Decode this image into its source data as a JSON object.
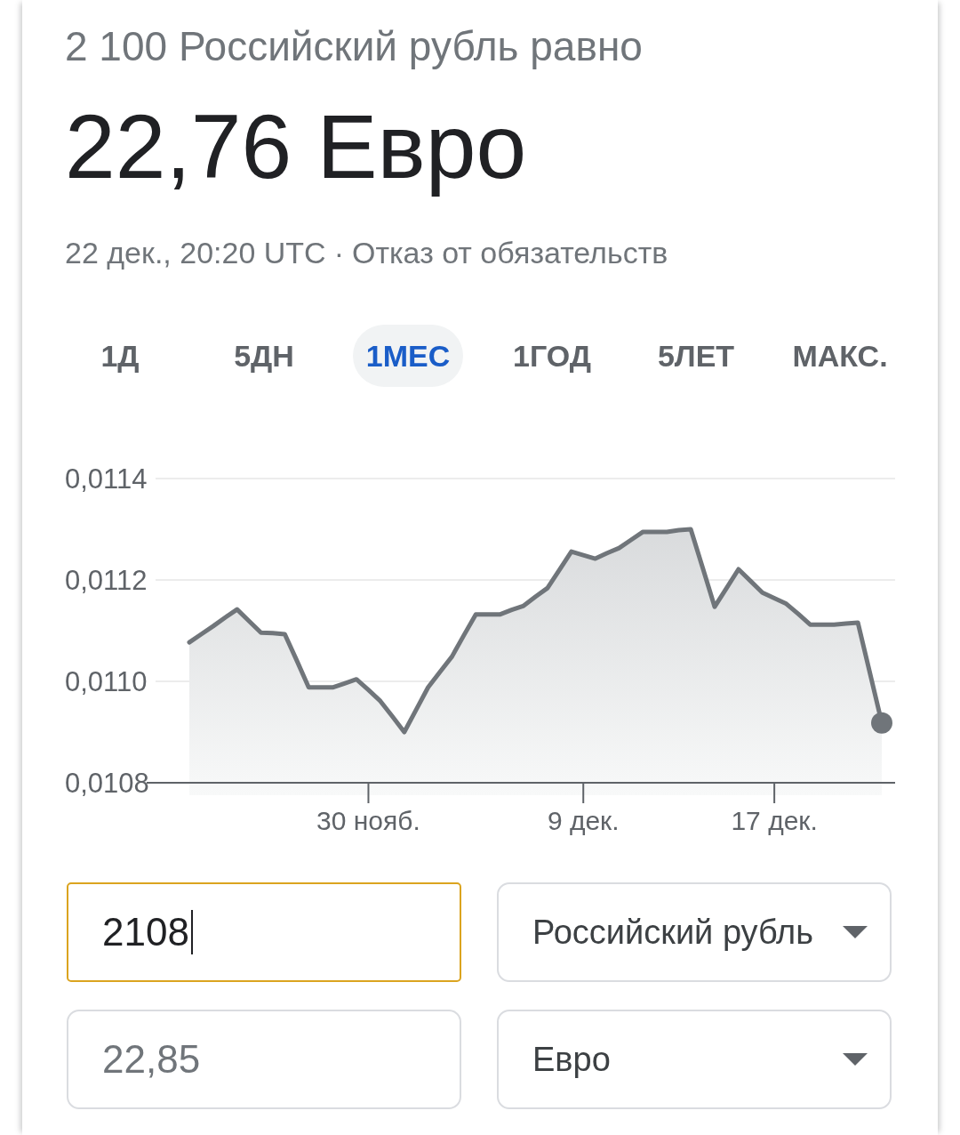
{
  "header": {
    "query": "2 100 Российский рубль равно",
    "result": "22,76 Евро",
    "timestamp": "22 дек., 20:20 UTC",
    "separator": "·",
    "disclaimer_link": "Отказ от обязательств"
  },
  "range_tabs": [
    {
      "label": "1Д",
      "selected": false
    },
    {
      "label": "5ДН",
      "selected": false
    },
    {
      "label": "1МЕС",
      "selected": true
    },
    {
      "label": "1ГОД",
      "selected": false
    },
    {
      "label": "5ЛЕТ",
      "selected": false
    },
    {
      "label": "МАКС.",
      "selected": false
    }
  ],
  "chart": {
    "chart_data": {
      "type": "area",
      "categories": [
        null,
        null,
        null,
        null,
        null,
        null,
        null,
        null,
        null,
        null,
        null,
        null,
        null,
        null,
        null,
        "30 нояб.",
        null,
        null,
        null,
        null,
        null,
        null,
        null,
        null,
        null,
        null,
        null,
        null,
        null,
        null,
        null,
        null,
        null,
        "9 дек.",
        null,
        null,
        null,
        null,
        null,
        null,
        null,
        null,
        null,
        null,
        null,
        null,
        null,
        null,
        null,
        "17 дек.",
        null,
        null,
        null,
        null,
        null,
        null,
        null,
        null,
        null
      ],
      "ylim": [
        0.0108,
        0.0114
      ],
      "yticks": [
        {
          "value": 0.0108,
          "label": "0,0108"
        },
        {
          "value": 0.011,
          "label": "0,0110"
        },
        {
          "value": 0.0112,
          "label": "0,0112"
        },
        {
          "value": 0.0114,
          "label": "0,0114"
        }
      ],
      "series": [
        {
          "color": "#70757a",
          "values": [
            0.011077,
            0.011093,
            0.011109,
            0.011126,
            0.011142,
            0.011119,
            0.011096,
            0.011095,
            0.011093,
            0.011041,
            0.010988,
            0.010988,
            0.010988,
            0.010996,
            0.011004,
            0.010983,
            0.010961,
            0.010931,
            0.0109,
            0.010944,
            0.010988,
            0.011019,
            0.011049,
            0.011091,
            0.011132,
            0.011132,
            0.011132,
            0.011141,
            0.011149,
            0.011167,
            0.011184,
            0.01122,
            0.011256,
            0.011249,
            0.011242,
            0.011253,
            0.011263,
            0.011279,
            0.011295,
            0.011295,
            0.011295,
            0.011298,
            0.0113,
            0.011224,
            0.011147,
            0.011184,
            0.011221,
            0.011198,
            0.011175,
            0.011164,
            0.011153,
            0.011133,
            0.011112,
            0.011112,
            0.011112,
            0.011114,
            0.011116,
            0.011017,
            0.010918
          ]
        }
      ]
    }
  },
  "converter": [
    {
      "amount": "2108",
      "focused": true,
      "currency": "Российский рубль"
    },
    {
      "amount": "22,85",
      "focused": false,
      "currency": "Евро"
    }
  ]
}
